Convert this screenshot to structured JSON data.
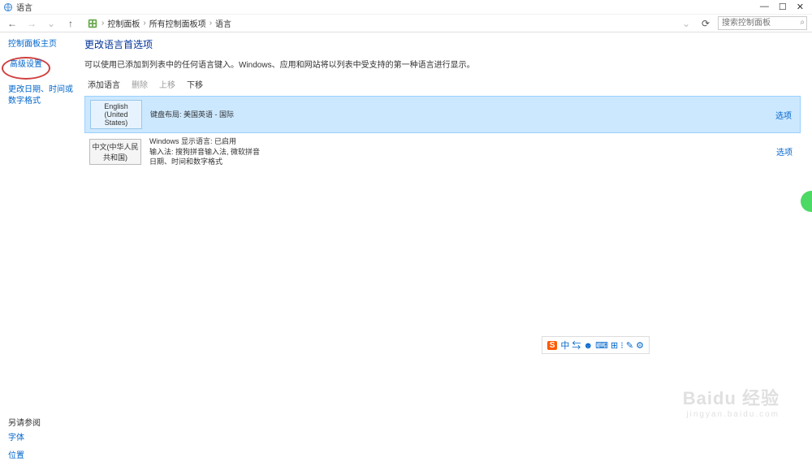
{
  "window": {
    "title": "语言"
  },
  "winbuttons": {
    "min": "—",
    "max": "☐",
    "close": "✕"
  },
  "nav": {
    "back": "←",
    "fwd": "→",
    "up": "↑",
    "refresh": "⟳",
    "dropdown": "⌄"
  },
  "breadcrumb": {
    "root": "控制面板",
    "mid": "所有控制面板项",
    "leaf": "语言",
    "sep": "›"
  },
  "search": {
    "placeholder": "搜索控制面板",
    "icon": "⌕"
  },
  "sidebar": {
    "home": "控制面板主页",
    "advanced": "高级设置",
    "dateformat": "更改日期、时间或数字格式",
    "seealso_header": "另请参阅",
    "seealso": [
      "字体",
      "位置"
    ]
  },
  "main": {
    "heading": "更改语言首选项",
    "desc": "可以使用已添加到列表中的任何语言键入。Windows、应用和网站将以列表中受支持的第一种语言进行显示。",
    "toolbar": {
      "add": "添加语言",
      "remove": "删除",
      "up": "上移",
      "down": "下移"
    }
  },
  "languages": [
    {
      "name": "English (United States)",
      "details": [
        "键盘布局: 美国英语 - 国际"
      ],
      "options": "选项",
      "selected": true
    },
    {
      "name": "中文(中华人民共和国)",
      "details": [
        "Windows 显示语言: 已启用",
        "输入法: 搜狗拼音输入法, 微软拼音",
        "日期、时间和数字格式"
      ],
      "options": "选项",
      "selected": false
    }
  ],
  "ime": {
    "brand": "S",
    "items": "中 ⇆ ☻ ⌨ ⊞ ⁝ ✎ ⚙"
  },
  "watermark": {
    "main": "Baidu 经验",
    "sub": "jingyan.baidu.com"
  }
}
